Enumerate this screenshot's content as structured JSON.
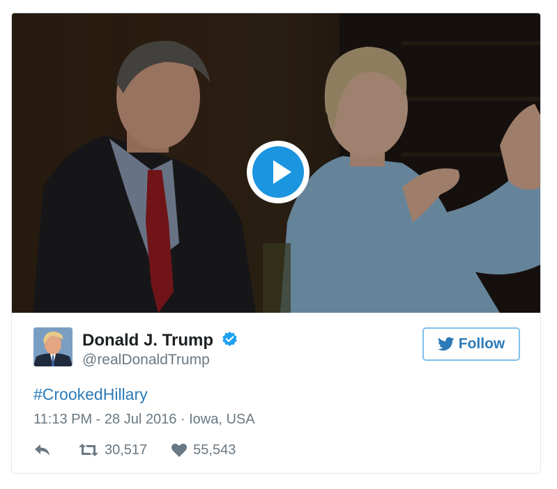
{
  "video": {
    "play_label": "play-icon"
  },
  "author": {
    "name": "Donald J. Trump",
    "handle": "@realDonaldTrump",
    "verified_icon": "verified-badge-icon",
    "verified_color": "#1da1f2"
  },
  "follow_button": {
    "label": "Follow",
    "icon": "twitter-bird-icon",
    "color": "#2b7bb9"
  },
  "tweet": {
    "text": "#CrookedHillary",
    "time": "11:13 PM - 28 Jul 2016",
    "separator": " · ",
    "location": "Iowa, USA"
  },
  "actions": {
    "reply_icon": "reply-icon",
    "retweet_icon": "retweet-icon",
    "retweet_count": "30,517",
    "like_icon": "heart-icon",
    "like_count": "55,543"
  },
  "colors": {
    "link": "#2b7bb9",
    "muted": "#697882",
    "play_button": "#1b95e0"
  }
}
